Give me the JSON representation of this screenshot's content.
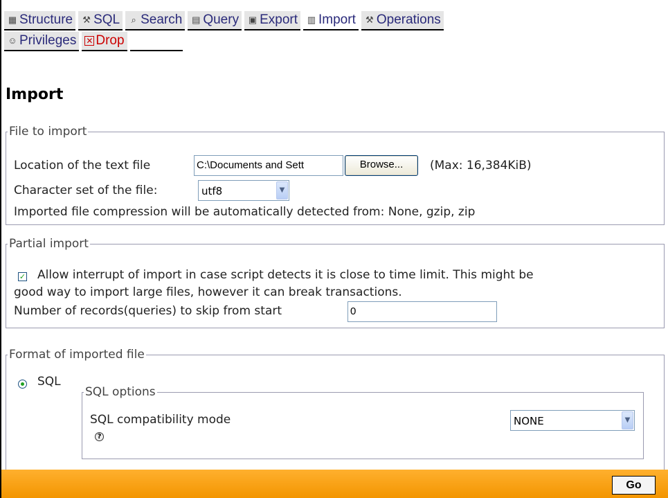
{
  "tabs": {
    "row1": [
      {
        "label": "Structure",
        "icon": "structure-icon"
      },
      {
        "label": "SQL",
        "icon": "sql-icon"
      },
      {
        "label": "Search",
        "icon": "search-icon"
      },
      {
        "label": "Query",
        "icon": "query-icon"
      },
      {
        "label": "Export",
        "icon": "export-icon"
      },
      {
        "label": "Import",
        "icon": "import-icon"
      },
      {
        "label": "Operations",
        "icon": "operations-icon"
      }
    ],
    "row2": [
      {
        "label": "Privileges",
        "icon": "privileges-icon"
      },
      {
        "label": "Drop",
        "icon": "drop-icon"
      }
    ]
  },
  "page_title": "Import",
  "file_to_import": {
    "legend": "File to import",
    "location_label": "Location of the text file",
    "location_value": "C:\\Documents and Sett",
    "browse_label": "Browse...",
    "max_label": "(Max: 16,384KiB)",
    "charset_label": "Character set of the file:",
    "charset_value": "utf8",
    "compression_note": "Imported file compression will be automatically detected from: None, gzip, zip"
  },
  "partial_import": {
    "legend": "Partial import",
    "allow_interrupt_checked": true,
    "allow_interrupt_text_line1": "Allow interrupt of import in case script detects it is close to time limit. This might be",
    "allow_interrupt_text_line2": "good way to import large files, however it can break transactions.",
    "skip_label": "Number of records(queries) to skip from start",
    "skip_value": "0"
  },
  "format": {
    "legend": "Format of imported file",
    "sql_label": "SQL",
    "sql_selected": true,
    "sql_options_legend": "SQL options",
    "compat_label": "SQL compatibility mode",
    "compat_value": "NONE"
  },
  "footer": {
    "go_label": "Go"
  },
  "colors": {
    "tab_text": "#2a2a7a",
    "drop_text": "#cc0000",
    "footer": "#f39500"
  }
}
